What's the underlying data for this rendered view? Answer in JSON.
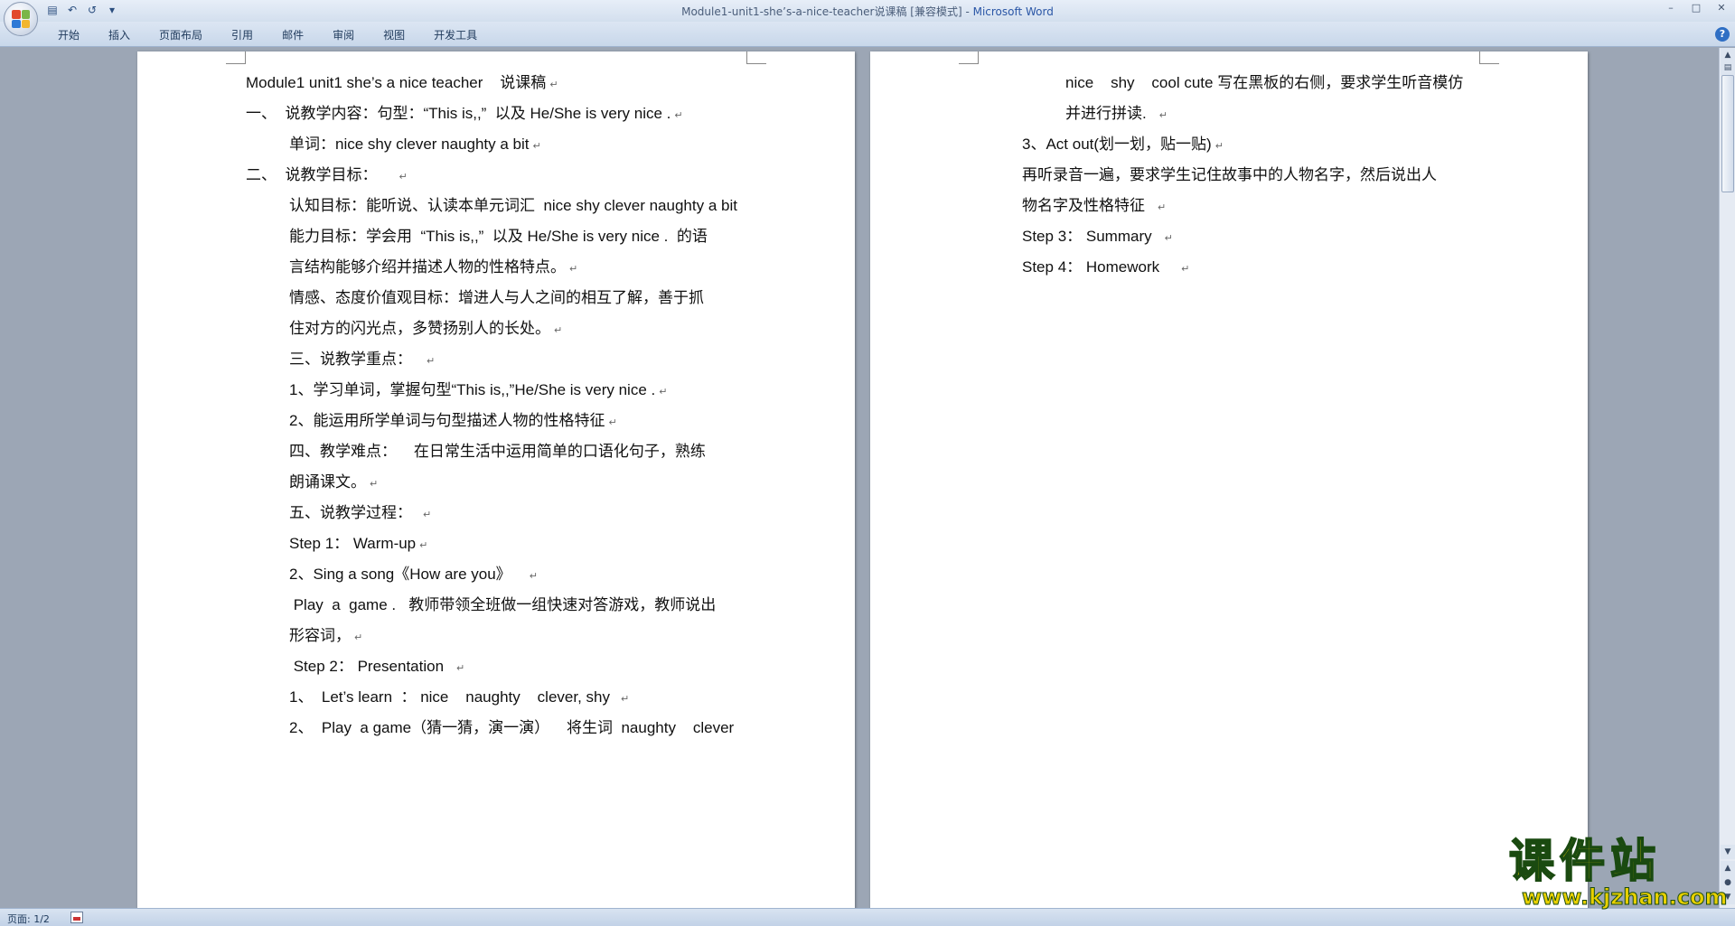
{
  "window": {
    "title_doc": "Module1-unit1-she’s-a-nice-teacher说课稿 [兼容模式] - ",
    "title_app": "Microsoft Word",
    "minimize_icon": "minimize-icon",
    "maximize_icon": "maximize-icon",
    "close_icon": "close-icon"
  },
  "quick_access": {
    "save_icon": "save-icon",
    "undo_icon": "undo-icon",
    "redo_icon": "redo-icon",
    "customize_icon": "dropdown-icon"
  },
  "ribbon": {
    "tabs": [
      "开始",
      "插入",
      "页面布局",
      "引用",
      "邮件",
      "审阅",
      "视图",
      "开发工具"
    ],
    "help_label": "?"
  },
  "page_left": {
    "lines": [
      "Module1 unit1 she’s a nice teacher    说课稿",
      "一、  说教学内容：句型：“This is,,”  以及 He/She is very nice .",
      "单词：nice shy clever naughty a bit",
      "二、  说教学目标：",
      "认知目标：能听说、认读本单元词汇  nice shy clever naughty a bit",
      "能力目标：学会用  “This is,,”  以及 He/She is very nice .  的语",
      "言结构能够介绍并描述人物的性格特点。",
      "情感、态度价值观目标：增进人与人之间的相互了解，善于抓",
      "住对方的闪光点，多赞扬别人的长处。",
      "三、说教学重点：",
      "1、学习单词，掌握句型“This is,,”He/She is very nice .",
      "2、能运用所学单词与句型描述人物的性格特征",
      "四、教学难点：    在日常生活中运用简单的口语化句子，熟练",
      "朗诵课文。",
      "五、说教学过程：",
      "Step 1： Warm-up",
      "2、Sing a song《How are you》",
      " Play  a  game .   教师带领全班做一组快速对答游戏，教师说出",
      "形容词，",
      " Step 2： Presentation",
      "1、  Let’s learn  ： nice    naughty    clever, shy",
      "2、  Play  a game（猜一猜，演一演）    将生词  naughty    clever"
    ]
  },
  "page_right": {
    "lines": [
      "nice    shy    cool cute 写在黑板的右侧，要求学生听音模仿",
      "并进行拼读.",
      "3、Act out(划一划，贴一贴)",
      "再听录音一遍，要求学生记住故事中的人物名字，然后说出人",
      "物名字及性格特征",
      "Step 3： Summary",
      "Step 4： Homework"
    ]
  },
  "paragraph_mark": "↵",
  "statusbar": {
    "page_info": "页面: 1/2"
  },
  "watermark": {
    "name": "课件站",
    "url": "www.kjzhan.com"
  }
}
